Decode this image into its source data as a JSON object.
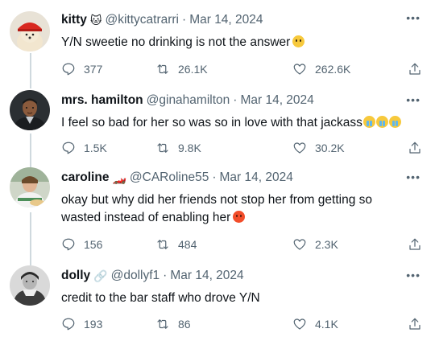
{
  "tweets": [
    {
      "name": "kitty",
      "badge": "🐱",
      "handle": "@kittycatrarri",
      "date": "Mar 14, 2024",
      "text": "Y/N sweetie no drinking is not the answer",
      "emoji": [
        "pleading"
      ],
      "replies": "377",
      "retweets": "26.1K",
      "likes": "262.6K"
    },
    {
      "name": "mrs. hamilton",
      "badge": "",
      "handle": "@ginahamilton",
      "date": "Mar 14, 2024",
      "text": "I feel so bad for her so was so in love with that jackass",
      "emoji": [
        "crying",
        "crying",
        "crying"
      ],
      "replies": "1.5K",
      "retweets": "9.8K",
      "likes": "30.2K"
    },
    {
      "name": "caroline",
      "badge": "🏎️",
      "handle": "@CARoline55",
      "date": "Mar 14, 2024",
      "text": "okay but why did her friends not stop her from getting so wasted instead of enabling her",
      "emoji": [
        "angry"
      ],
      "replies": "156",
      "retweets": "484",
      "likes": "2.3K"
    },
    {
      "name": "dolly",
      "badge": "🔗",
      "handle": "@dollyf1",
      "date": "Mar 14, 2024",
      "text": "credit to the bar staff who drove Y/N",
      "emoji": [],
      "replies": "193",
      "retweets": "86",
      "likes": "4.1K"
    }
  ],
  "separator": "·",
  "more_label": "•••",
  "icons": {
    "reply": "reply-icon",
    "retweet": "retweet-icon",
    "like": "heart-icon",
    "share": "share-icon"
  },
  "colors": {
    "text": "#0f1419",
    "secondary": "#536471",
    "thread_line": "#cfd9de"
  }
}
